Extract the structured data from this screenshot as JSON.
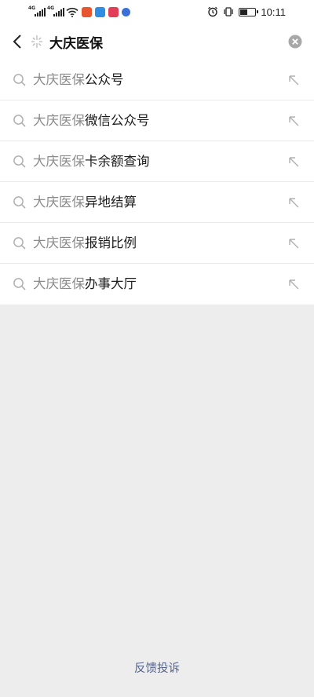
{
  "status_bar": {
    "network_left": "4G",
    "network_right": "4G",
    "time": "10:11",
    "battery_level": 0.5,
    "app_icon_colors": [
      "#e8562f",
      "#2f8de4",
      "#e23e57",
      "#3b6fd8"
    ]
  },
  "search": {
    "query": "大庆医保",
    "back_icon": "chevron-left-icon",
    "sparkle_icon": "sparkle-icon",
    "clear_icon": "clear-circle-icon"
  },
  "suggestions": [
    {
      "keyword": "大庆医保",
      "rest": "公众号",
      "highlighted": true
    },
    {
      "keyword": "大庆医保",
      "rest": "微信公众号",
      "highlighted": false
    },
    {
      "keyword": "大庆医保",
      "rest": "卡余额查询",
      "highlighted": false
    },
    {
      "keyword": "大庆医保",
      "rest": "异地结算",
      "highlighted": false
    },
    {
      "keyword": "大庆医保",
      "rest": "报销比例",
      "highlighted": false
    },
    {
      "keyword": "大庆医保",
      "rest": "办事大厅",
      "highlighted": false
    }
  ],
  "feedback": "反馈投诉",
  "colors": {
    "highlight_border": "#d9413d",
    "link": "#56638a",
    "keyword_gray": "#8a8a8a",
    "background": "#ededed"
  }
}
